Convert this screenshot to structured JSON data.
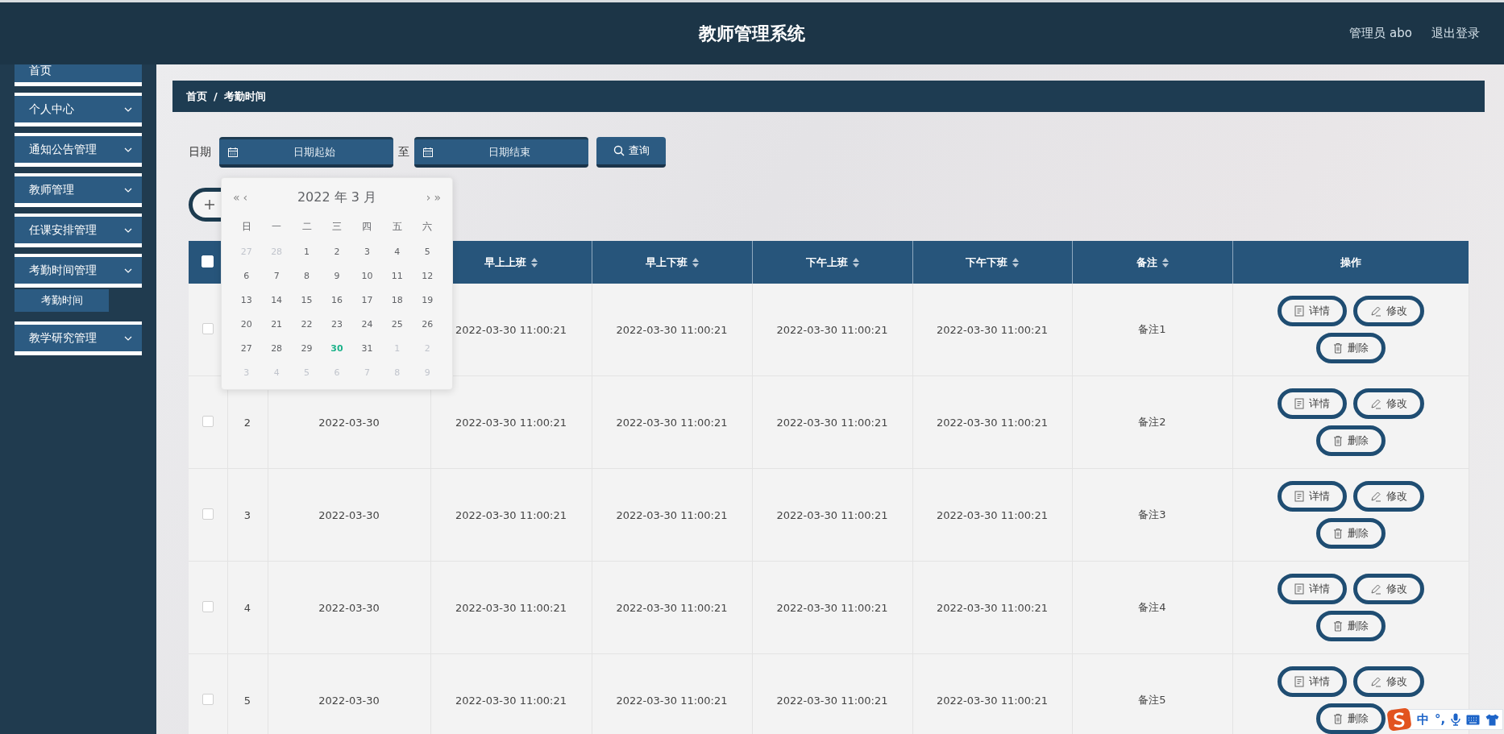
{
  "header": {
    "title": "教师管理系统",
    "user": "管理员 abo",
    "logout": "退出登录"
  },
  "sidebar": {
    "items": [
      {
        "kind": "link",
        "label": "首页"
      },
      {
        "kind": "group",
        "label": "个人中心"
      },
      {
        "kind": "group",
        "label": "通知公告管理"
      },
      {
        "kind": "group",
        "label": "教师管理"
      },
      {
        "kind": "group",
        "label": "任课安排管理"
      },
      {
        "kind": "group",
        "label": "考勤时间管理",
        "children": [
          {
            "label": "考勤时间",
            "selected": true
          }
        ]
      },
      {
        "kind": "group",
        "label": "教学研究管理"
      }
    ]
  },
  "breadcrumb": {
    "items": [
      "首页",
      "考勤时间"
    ],
    "separator": "/"
  },
  "filter": {
    "label": "日期",
    "start_placeholder": "日期起始",
    "to": "至",
    "end_placeholder": "日期结束",
    "search_button": "查询"
  },
  "table": {
    "header_checked": false,
    "columns": [
      {
        "kind": "index"
      },
      {
        "kind": "date"
      },
      {
        "kind": "text",
        "label": "早上上班",
        "sortable": true
      },
      {
        "kind": "text",
        "label": "早上下班",
        "sortable": true
      },
      {
        "kind": "text",
        "label": "下午上班",
        "sortable": true
      },
      {
        "kind": "text",
        "label": "下午下班",
        "sortable": true
      },
      {
        "kind": "text",
        "label": "备注",
        "sortable": true
      },
      {
        "kind": "actions",
        "label": "操作",
        "sortable": false
      }
    ],
    "rows": [
      {
        "checked": false,
        "cells": [
          "",
          "",
          "2022-03-30 11:00:21",
          "2022-03-30 11:00:21",
          "2022-03-30 11:00:21",
          "2022-03-30 11:00:21",
          "备注1"
        ],
        "actions": [
          {
            "kind": "detail",
            "label": "详情"
          },
          {
            "kind": "edit",
            "label": "修改"
          },
          {
            "kind": "delete",
            "label": "删除"
          }
        ]
      },
      {
        "checked": false,
        "cells": [
          "2",
          "2022-03-30",
          "2022-03-30 11:00:21",
          "2022-03-30 11:00:21",
          "2022-03-30 11:00:21",
          "2022-03-30 11:00:21",
          "备注2"
        ],
        "actions": [
          {
            "kind": "detail",
            "label": "详情"
          },
          {
            "kind": "edit",
            "label": "修改"
          },
          {
            "kind": "delete",
            "label": "删除"
          }
        ]
      },
      {
        "checked": false,
        "cells": [
          "3",
          "2022-03-30",
          "2022-03-30 11:00:21",
          "2022-03-30 11:00:21",
          "2022-03-30 11:00:21",
          "2022-03-30 11:00:21",
          "备注3"
        ],
        "actions": [
          {
            "kind": "detail",
            "label": "详情"
          },
          {
            "kind": "edit",
            "label": "修改"
          },
          {
            "kind": "delete",
            "label": "删除"
          }
        ]
      },
      {
        "checked": false,
        "cells": [
          "4",
          "2022-03-30",
          "2022-03-30 11:00:21",
          "2022-03-30 11:00:21",
          "2022-03-30 11:00:21",
          "2022-03-30 11:00:21",
          "备注4"
        ],
        "actions": [
          {
            "kind": "detail",
            "label": "详情"
          },
          {
            "kind": "edit",
            "label": "修改"
          },
          {
            "kind": "delete",
            "label": "删除"
          }
        ]
      },
      {
        "checked": false,
        "cells": [
          "5",
          "2022-03-30",
          "2022-03-30 11:00:21",
          "2022-03-30 11:00:21",
          "2022-03-30 11:00:21",
          "2022-03-30 11:00:21",
          "备注5"
        ],
        "actions": [
          {
            "kind": "detail",
            "label": "详情"
          },
          {
            "kind": "edit",
            "label": "修改"
          },
          {
            "kind": "delete",
            "label": "删除"
          }
        ]
      }
    ]
  },
  "calendar": {
    "prev_year": "«",
    "prev_month": "‹",
    "title": "2022 年  3 月",
    "next_month": "›",
    "next_year": "»",
    "weekdays": [
      "日",
      "一",
      "二",
      "三",
      "四",
      "五",
      "六"
    ],
    "weeks": [
      [
        {
          "day": "27",
          "other_month": true,
          "today": false
        },
        {
          "day": "28",
          "other_month": true,
          "today": false
        },
        {
          "day": "1",
          "other_month": false,
          "today": false
        },
        {
          "day": "2",
          "other_month": false,
          "today": false
        },
        {
          "day": "3",
          "other_month": false,
          "today": false
        },
        {
          "day": "4",
          "other_month": false,
          "today": false
        },
        {
          "day": "5",
          "other_month": false,
          "today": false
        }
      ],
      [
        {
          "day": "6",
          "other_month": false,
          "today": false
        },
        {
          "day": "7",
          "other_month": false,
          "today": false
        },
        {
          "day": "8",
          "other_month": false,
          "today": false
        },
        {
          "day": "9",
          "other_month": false,
          "today": false
        },
        {
          "day": "10",
          "other_month": false,
          "today": false
        },
        {
          "day": "11",
          "other_month": false,
          "today": false
        },
        {
          "day": "12",
          "other_month": false,
          "today": false
        }
      ],
      [
        {
          "day": "13",
          "other_month": false,
          "today": false
        },
        {
          "day": "14",
          "other_month": false,
          "today": false
        },
        {
          "day": "15",
          "other_month": false,
          "today": false
        },
        {
          "day": "16",
          "other_month": false,
          "today": false
        },
        {
          "day": "17",
          "other_month": false,
          "today": false
        },
        {
          "day": "18",
          "other_month": false,
          "today": false
        },
        {
          "day": "19",
          "other_month": false,
          "today": false
        }
      ],
      [
        {
          "day": "20",
          "other_month": false,
          "today": false
        },
        {
          "day": "21",
          "other_month": false,
          "today": false
        },
        {
          "day": "22",
          "other_month": false,
          "today": false
        },
        {
          "day": "23",
          "other_month": false,
          "today": false
        },
        {
          "day": "24",
          "other_month": false,
          "today": false
        },
        {
          "day": "25",
          "other_month": false,
          "today": false
        },
        {
          "day": "26",
          "other_month": false,
          "today": false
        }
      ],
      [
        {
          "day": "27",
          "other_month": false,
          "today": false
        },
        {
          "day": "28",
          "other_month": false,
          "today": false
        },
        {
          "day": "29",
          "other_month": false,
          "today": false
        },
        {
          "day": "30",
          "other_month": false,
          "today": true
        },
        {
          "day": "31",
          "other_month": false,
          "today": false
        },
        {
          "day": "1",
          "other_month": true,
          "today": false
        },
        {
          "day": "2",
          "other_month": true,
          "today": false
        }
      ],
      [
        {
          "day": "3",
          "other_month": true,
          "today": false
        },
        {
          "day": "4",
          "other_month": true,
          "today": false
        },
        {
          "day": "5",
          "other_month": true,
          "today": false
        },
        {
          "day": "6",
          "other_month": true,
          "today": false
        },
        {
          "day": "7",
          "other_month": true,
          "today": false
        },
        {
          "day": "8",
          "other_month": true,
          "today": false
        },
        {
          "day": "9",
          "other_month": true,
          "today": false
        }
      ]
    ]
  },
  "ime": {
    "mode": "中",
    "punctuation": "°,"
  }
}
